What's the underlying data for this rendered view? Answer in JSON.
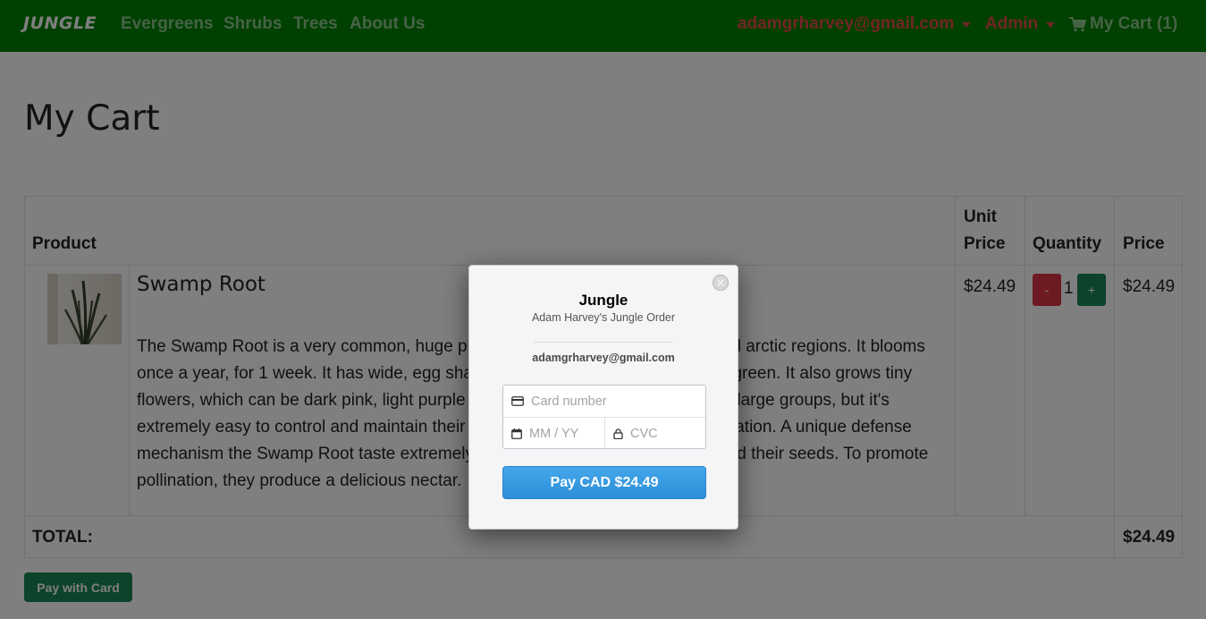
{
  "navbar": {
    "brand": "JUNGLE",
    "links": [
      "Evergreens",
      "Shrubs",
      "Trees",
      "About Us"
    ],
    "user_email": "adamgrharvey@gmail.com",
    "admin_label": "Admin",
    "cart_label": "My Cart (1)"
  },
  "page": {
    "title": "My Cart"
  },
  "table": {
    "headers": {
      "product": "Product",
      "unit_price_line1": "Unit",
      "unit_price_line2": "Price",
      "quantity": "Quantity",
      "price": "Price"
    },
    "rows": [
      {
        "name": "Swamp Root",
        "description": "The Swamp Root is a very common, huge plant that can be found in tropical and arctic regions. It blooms once a year, for 1 week. It has wide, egg shaped leaves which are usually dark green. It also grows tiny flowers, which can be dark pink, light purple and dark green. The plant grows in large groups, but it's extremely easy to control and maintain their growth. They can be used as decoration. A unique defense mechanism the Swamp Root taste extremely sour. They rely on insects to spread their seeds. To promote pollination, they produce a delicious nectar.",
        "unit_price": "$24.49",
        "quantity": "1",
        "price": "$24.49",
        "minus_label": "-",
        "plus_label": "+"
      }
    ],
    "total_label": "TOTAL:",
    "total_value": "$24.49"
  },
  "pay_with_card_label": "Pay with Card",
  "modal": {
    "title": "Jungle",
    "subtitle": "Adam Harvey's Jungle Order",
    "email": "adamgrharvey@gmail.com",
    "card_number_placeholder": "Card number",
    "expiry_placeholder": "MM / YY",
    "cvc_placeholder": "CVC",
    "pay_button_label": "Pay CAD $24.49",
    "close_symbol": "×"
  },
  "colors": {
    "navbar_bg": "#008000",
    "nav_user": "#e44a4a",
    "minus_btn": "#dc3545",
    "plus_btn": "#198754",
    "pay_btn": "#3399e0"
  }
}
